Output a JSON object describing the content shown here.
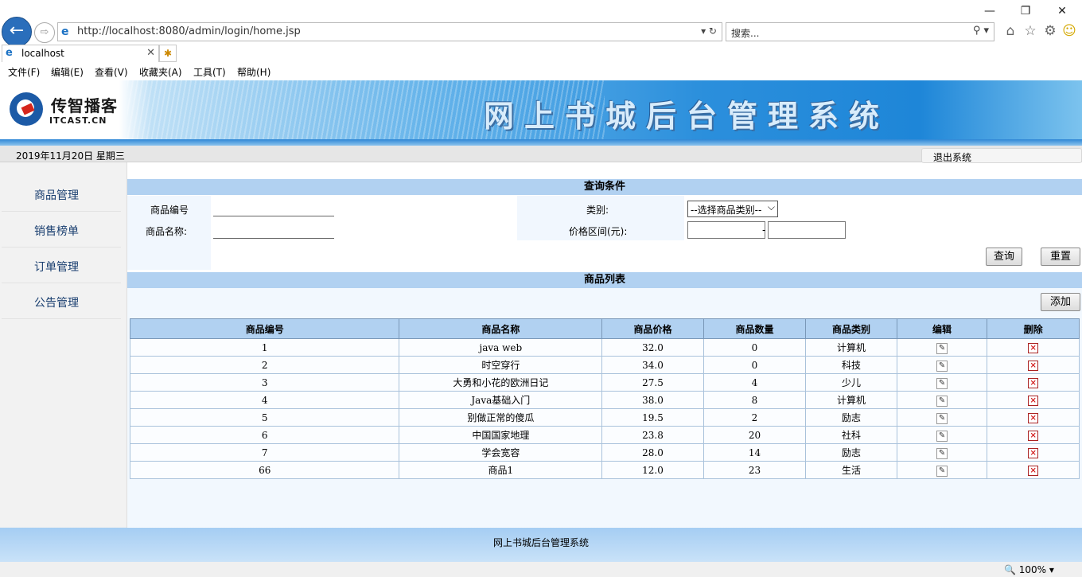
{
  "browser": {
    "url": "http://localhost:8080/admin/login/home.jsp",
    "search_placeholder": "搜索...",
    "tab_title": "localhost",
    "menu": [
      "文件(F)",
      "编辑(E)",
      "查看(V)",
      "收藏夹(A)",
      "工具(T)",
      "帮助(H)"
    ],
    "zoom": "100%"
  },
  "header": {
    "logo_cn": "传智播客",
    "logo_en": "ITCAST.CN",
    "title": "网上书城后台管理系统",
    "date": "2019年11月20日 星期三",
    "logout": "退出系统"
  },
  "sidebar": {
    "items": [
      {
        "label": "商品管理"
      },
      {
        "label": "销售榜单"
      },
      {
        "label": "订单管理"
      },
      {
        "label": "公告管理"
      }
    ]
  },
  "query": {
    "title": "查询条件",
    "id_label": "商品编号",
    "name_label": "商品名称:",
    "category_label": "类别:",
    "category_selected": "--选择商品类别--",
    "price_label": "价格区间(元):",
    "price_dash": "-",
    "query_button": "查询",
    "reset_button": "重置"
  },
  "list": {
    "title": "商品列表",
    "add_button": "添加",
    "columns": [
      "商品编号",
      "商品名称",
      "商品价格",
      "商品数量",
      "商品类别",
      "编辑",
      "删除"
    ],
    "rows": [
      {
        "id": "1",
        "name": "java web",
        "price": "32.0",
        "qty": "0",
        "category": "计算机"
      },
      {
        "id": "2",
        "name": "时空穿行",
        "price": "34.0",
        "qty": "0",
        "category": "科技"
      },
      {
        "id": "3",
        "name": "大勇和小花的欧洲日记",
        "price": "27.5",
        "qty": "4",
        "category": "少儿"
      },
      {
        "id": "4",
        "name": "Java基础入门",
        "price": "38.0",
        "qty": "8",
        "category": "计算机"
      },
      {
        "id": "5",
        "name": "别做正常的傻瓜",
        "price": "19.5",
        "qty": "2",
        "category": "励志"
      },
      {
        "id": "6",
        "name": "中国国家地理",
        "price": "23.8",
        "qty": "20",
        "category": "社科"
      },
      {
        "id": "7",
        "name": "学会宽容",
        "price": "28.0",
        "qty": "14",
        "category": "励志"
      },
      {
        "id": "66",
        "name": "商品1",
        "price": "12.0",
        "qty": "23",
        "category": "生活"
      }
    ]
  },
  "footer": {
    "text": "网上书城后台管理系统"
  }
}
